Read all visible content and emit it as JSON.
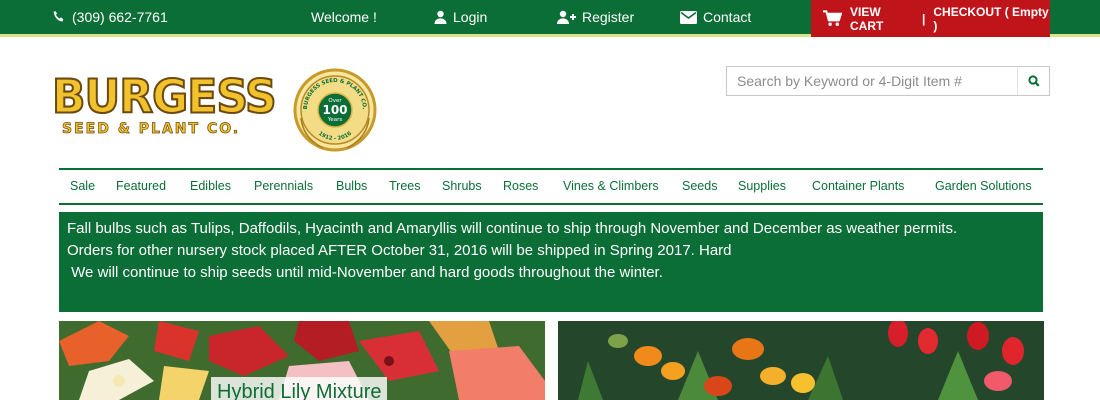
{
  "topbar": {
    "phone": "(309) 662-7761",
    "welcome": "Welcome !",
    "login": "Login",
    "register": "Register",
    "contact": "Contact",
    "view_cart": "VIEW CART",
    "separator": "|",
    "checkout": "CHECKOUT ( Empty )"
  },
  "logo": {
    "brand": "BURGESS",
    "sub": "SEED & PLANT CO.",
    "seal_top": "BURGESS SEED & PLANT CO.",
    "seal_center_1": "Over",
    "seal_center_2": "100",
    "seal_center_3": "Years",
    "seal_years": "1912 - 2016"
  },
  "search": {
    "placeholder": "Search by Keyword or 4-Digit Item #"
  },
  "nav": {
    "items": [
      "Sale",
      "Featured",
      "Edibles",
      "Perennials",
      "Bulbs",
      "Trees",
      "Shrubs",
      "Roses",
      "Vines & Climbers",
      "Seeds",
      "Supplies",
      "Container Plants",
      "Garden Solutions"
    ]
  },
  "notice": {
    "line1": "Fall bulbs such as Tulips, Daffodils, Hyacinth and Amaryllis will continue to ship through November and December as weather permits.",
    "line2": "Orders for other nursery stock placed AFTER October 31, 2016 will be shipped in Spring 2017. Hard",
    "line3": " We will continue to ship seeds until mid-November and hard goods throughout the winter."
  },
  "promo": {
    "left_caption": "Hybrid Lily Mixture"
  },
  "colors": {
    "brand_green": "#0b6e37",
    "cart_red": "#c0141b",
    "logo_gold": "#f2c22c"
  }
}
